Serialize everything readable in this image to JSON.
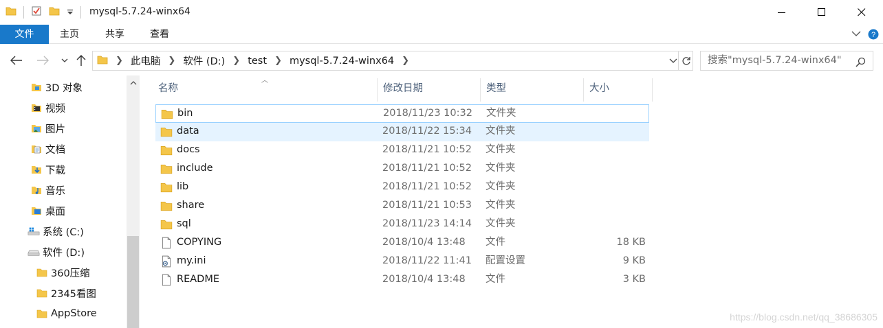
{
  "window": {
    "title": "mysql-5.7.24-winx64"
  },
  "ribbon": {
    "tabs": [
      "文件",
      "主页",
      "共享",
      "查看"
    ]
  },
  "address": {
    "crumbs": [
      "此电脑",
      "软件 (D:)",
      "test",
      "mysql-5.7.24-winx64"
    ]
  },
  "search": {
    "placeholder": "搜索\"mysql-5.7.24-winx64\""
  },
  "nav": {
    "items": [
      {
        "label": "3D 对象",
        "icon": "3d-objects-icon"
      },
      {
        "label": "视频",
        "icon": "video-icon"
      },
      {
        "label": "图片",
        "icon": "pictures-icon"
      },
      {
        "label": "文档",
        "icon": "documents-icon"
      },
      {
        "label": "下载",
        "icon": "downloads-icon"
      },
      {
        "label": "音乐",
        "icon": "music-icon"
      },
      {
        "label": "桌面",
        "icon": "desktop-icon"
      },
      {
        "label": "系统 (C:)",
        "icon": "system-drive-icon"
      },
      {
        "label": "软件 (D:)",
        "icon": "drive-icon"
      },
      {
        "label": "360压缩",
        "icon": "folder-icon"
      },
      {
        "label": "2345看图",
        "icon": "folder-icon"
      },
      {
        "label": "AppStore",
        "icon": "folder-icon"
      }
    ]
  },
  "columns": {
    "name": "名称",
    "date": "修改日期",
    "type": "类型",
    "size": "大小"
  },
  "files": [
    {
      "name": "bin",
      "date": "2018/11/23 10:32",
      "type": "文件夹",
      "size": "",
      "icon": "folder-icon"
    },
    {
      "name": "data",
      "date": "2018/11/22 15:34",
      "type": "文件夹",
      "size": "",
      "icon": "folder-icon"
    },
    {
      "name": "docs",
      "date": "2018/11/21 10:52",
      "type": "文件夹",
      "size": "",
      "icon": "folder-icon"
    },
    {
      "name": "include",
      "date": "2018/11/21 10:52",
      "type": "文件夹",
      "size": "",
      "icon": "folder-icon"
    },
    {
      "name": "lib",
      "date": "2018/11/21 10:52",
      "type": "文件夹",
      "size": "",
      "icon": "folder-icon"
    },
    {
      "name": "share",
      "date": "2018/11/21 10:53",
      "type": "文件夹",
      "size": "",
      "icon": "folder-icon"
    },
    {
      "name": "sql",
      "date": "2018/11/23 14:14",
      "type": "文件夹",
      "size": "",
      "icon": "folder-icon"
    },
    {
      "name": "COPYING",
      "date": "2018/10/4 13:48",
      "type": "文件",
      "size": "18 KB",
      "icon": "file-icon"
    },
    {
      "name": "my.ini",
      "date": "2018/11/22 11:41",
      "type": "配置设置",
      "size": "9 KB",
      "icon": "settings-file-icon"
    },
    {
      "name": "README",
      "date": "2018/10/4 13:48",
      "type": "文件",
      "size": "3 KB",
      "icon": "file-icon"
    }
  ],
  "watermark": "https://blog.csdn.net/qq_38686305",
  "colors": {
    "accent": "#1979ca",
    "folder": "#f4c64a",
    "hover": "#e5f3ff",
    "focus_border": "#99d1ff"
  }
}
